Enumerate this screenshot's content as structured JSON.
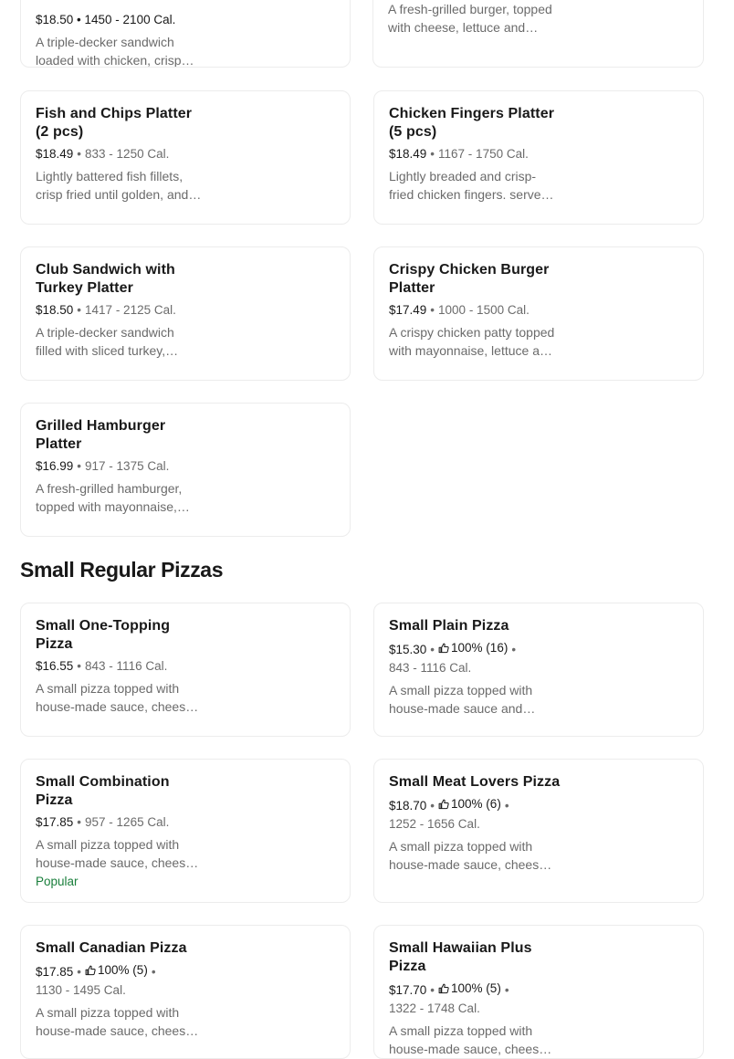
{
  "top_cards": [
    {
      "meta_partial": "$18.50 • 1450 - 2100 Cal.",
      "desc": "A triple-decker sandwich loaded with chicken, crisp bacon and lettuce."
    },
    {
      "desc": "A fresh-grilled burger, topped with cheese, lettuce and tomato."
    }
  ],
  "platters": [
    {
      "name": "Fish and Chips Platter (2 pcs)",
      "price": "$18.49",
      "cal": "833 - 1250 Cal.",
      "desc": "Lightly battered fish fillets, crisp fried until golden, and served with fries."
    },
    {
      "name": "Chicken Fingers Platter (5 pcs)",
      "price": "$18.49",
      "cal": "1167 - 1750 Cal.",
      "desc": "Lightly breaded and crisp-fried chicken fingers. served with fries."
    },
    {
      "name": "Club Sandwich with Turkey Platter",
      "price": "$18.50",
      "cal": "1417 - 2125 Cal.",
      "desc": "A triple-decker sandwich filled with sliced turkey, bacon and lettuce."
    },
    {
      "name": "Crispy Chicken Burger Platter",
      "price": "$17.49",
      "cal": "1000 - 1500 Cal.",
      "desc": "A crispy chicken patty topped with mayonnaise, lettuce and tomato."
    },
    {
      "name": "Grilled Hamburger Platter",
      "price": "$16.99",
      "cal": "917 - 1375 Cal.",
      "desc": "A fresh-grilled hamburger, topped with mayonnaise, lettuce and tomato."
    }
  ],
  "section_title": "Small Regular Pizzas",
  "pizzas": [
    {
      "name": "Small One-Topping Pizza",
      "price": "$16.55",
      "rating": "",
      "cal": "843 - 1116 Cal.",
      "desc": "A small pizza topped with house-made sauce, cheese and your choice of topping.",
      "badge": ""
    },
    {
      "name": "Small Plain Pizza",
      "price": "$15.30",
      "rating": "100% (16)",
      "cal": "843 - 1116 Cal.",
      "desc": "A small pizza topped with house-made sauce and mozzarella cheese.",
      "badge": ""
    },
    {
      "name": "Small Combination Pizza",
      "price": "$17.85",
      "rating": "",
      "cal": "957 - 1265 Cal.",
      "desc": "A small pizza topped with house-made sauce, cheese, pepperoni, mushrooms and green peppers.",
      "badge": "Popular"
    },
    {
      "name": "Small Meat Lovers Pizza",
      "price": "$18.70",
      "rating": "100% (6)",
      "cal": "1252 - 1656 Cal.",
      "desc": "A small pizza topped with house-made sauce, cheese, pepperoni, bacon and sausage.",
      "badge": ""
    },
    {
      "name": "Small Canadian Pizza",
      "price": "$17.85",
      "rating": "100% (5)",
      "cal": "1130 - 1495 Cal.",
      "desc": "A small pizza topped with house-made sauce, cheese, pepperoni, mushrooms and bacon.",
      "badge": ""
    },
    {
      "name": "Small Hawaiian Plus Pizza",
      "price": "$17.70",
      "rating": "100% (5)",
      "cal": "1322 - 1748 Cal.",
      "desc": "A small pizza topped with house-made sauce, cheese, ham, pineapple and bacon.",
      "badge": ""
    }
  ],
  "colors": {
    "popular": "#1a7f3c",
    "muted": "#6b6b6b",
    "text": "#191919",
    "border": "#ececec"
  },
  "icons": {
    "rating": "thumbs-up-icon"
  }
}
